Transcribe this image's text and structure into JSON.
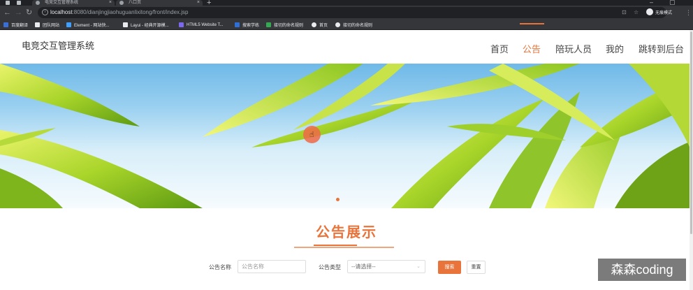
{
  "browser": {
    "tabs": [
      {
        "title": "电竞交互管理系统"
      },
      {
        "title": "八口页"
      }
    ],
    "new_tab": "+",
    "url_host": "localhost",
    "url_path": ":8080/dianjingjiaohuguanlixitong/front/index.jsp",
    "profile_label": "无痕模式",
    "bookmarks": [
      {
        "label": "百度翻译",
        "color": "#3b6fd8"
      },
      {
        "label": "团队网站",
        "color": "#e8eaed"
      },
      {
        "label": "Element - 网站快...",
        "color": "#409eff"
      },
      {
        "label": "Layui - 经典开源模...",
        "color": "#e8eaed"
      },
      {
        "label": "HTML5 Website T...",
        "color": "#7b68ee"
      },
      {
        "label": "搜索学练",
        "color": "#2f6fd8"
      },
      {
        "label": "接切的命名规则",
        "color": "#34a853"
      },
      {
        "label": "首页",
        "color": "#e8eaed"
      },
      {
        "label": "接切的命名规则",
        "color": "#e8eaed"
      }
    ]
  },
  "site": {
    "title": "电竞交互管理系统",
    "nav": [
      {
        "label": "首页"
      },
      {
        "label": "公告"
      },
      {
        "label": "陪玩人员"
      },
      {
        "label": "我的"
      },
      {
        "label": "跳转到后台"
      }
    ],
    "active_nav_index": 1,
    "accent_color": "#e8743b"
  },
  "notice": {
    "title": "公告展示",
    "name_label": "公告名称",
    "name_placeholder": "公告名称",
    "type_label": "公告类型",
    "type_selected": "--请选择--",
    "search_button": "搜索",
    "reset_button": "重置"
  },
  "watermark": "森森coding"
}
